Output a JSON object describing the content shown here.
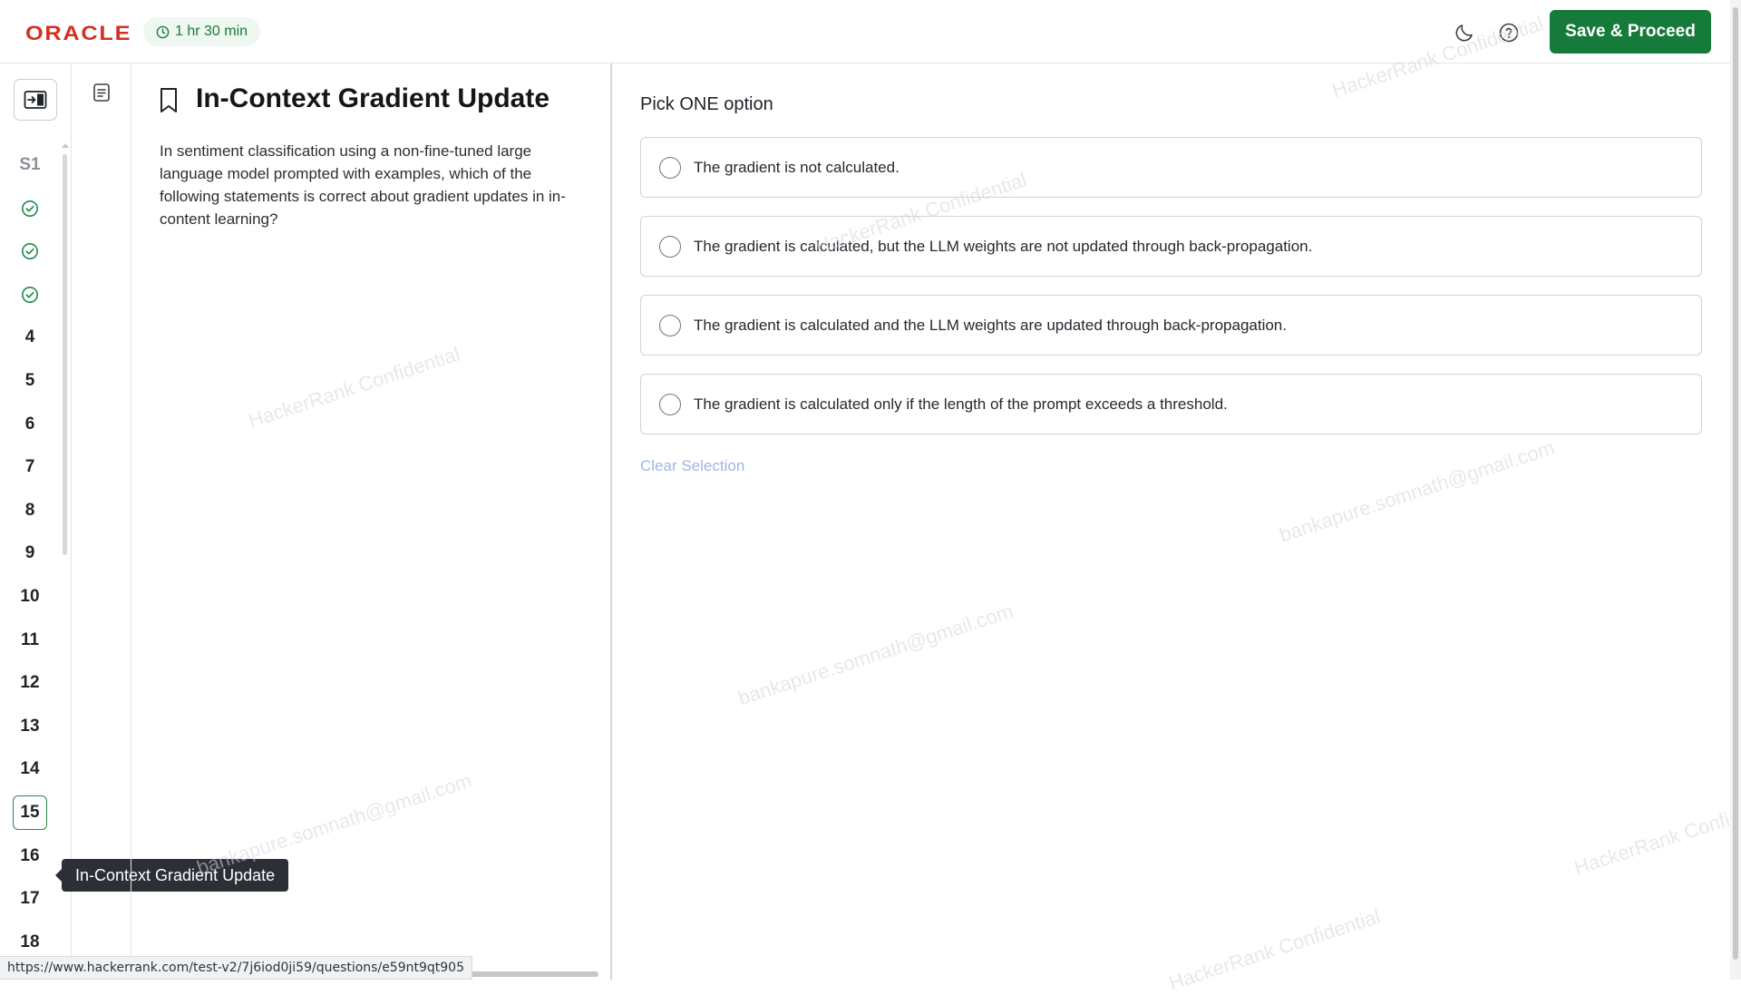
{
  "header": {
    "logo": "ORACLE",
    "timer": "1 hr 30 min",
    "theme_icon": "moon-icon",
    "help_icon": "help-circle-icon",
    "save_label": "Save & Proceed",
    "accent_color": "#157a3a"
  },
  "nav": {
    "section_label": "S1",
    "completed_icon": "check-circle-icon",
    "completed_count": 3,
    "numbers": [
      "4",
      "5",
      "6",
      "7",
      "8",
      "9",
      "10",
      "11",
      "12",
      "13",
      "14",
      "15",
      "16",
      "17",
      "18"
    ],
    "current": "15",
    "tooltip": "In-Context Gradient Update"
  },
  "question": {
    "title": "In-Context Gradient Update",
    "text": "In sentiment classification using a non-fine-tuned large language model prompted with examples, which of the following statements is correct about gradient updates in in-content learning?"
  },
  "answers": {
    "instruction": "Pick ONE option",
    "options": [
      "The gradient is not calculated.",
      "The gradient is calculated, but the LLM weights are not updated through back-propagation.",
      "The gradient is calculated and the LLM weights are updated through back-propagation.",
      "The gradient is calculated only if the length of the prompt exceeds a threshold."
    ],
    "clear_label": "Clear Selection"
  },
  "watermarks": {
    "confidential": "HackerRank Confidential",
    "email": "bankapure.somnath@gmail.com"
  },
  "status_url": "https://www.hackerrank.com/test-v2/7j6iod0ji59/questions/e59nt9qt905"
}
